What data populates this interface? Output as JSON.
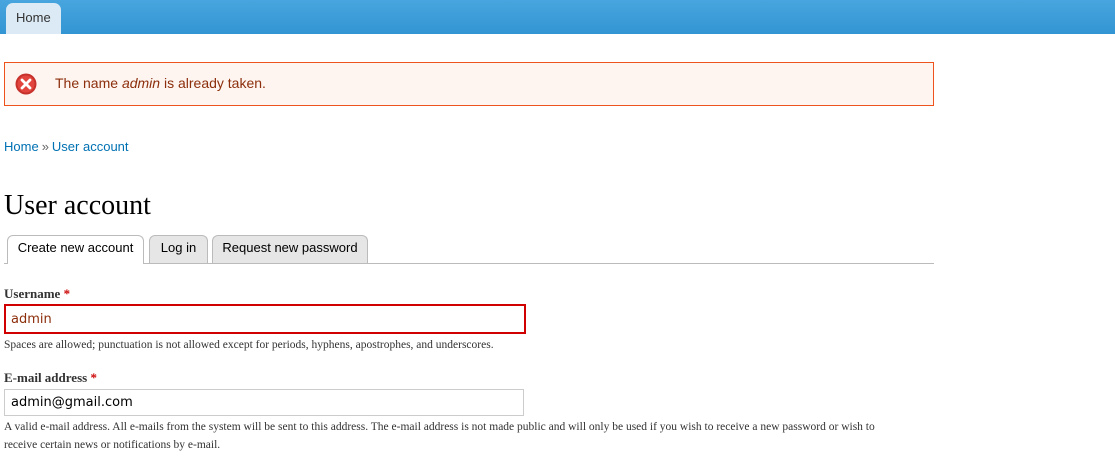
{
  "topbar": {
    "home_tab_label": "Home"
  },
  "error": {
    "icon": "error-x-icon",
    "text_before": "The name ",
    "text_name": "admin",
    "text_after": " is already taken."
  },
  "breadcrumb": {
    "home": "Home",
    "separator": "»",
    "current": "User account"
  },
  "page": {
    "title": "User account"
  },
  "tabs": [
    {
      "label": "Create new account",
      "active": true
    },
    {
      "label": "Log in",
      "active": false
    },
    {
      "label": "Request new password",
      "active": false
    }
  ],
  "form": {
    "username": {
      "label": "Username",
      "required_marker": "*",
      "value": "admin",
      "description": "Spaces are allowed; punctuation is not allowed except for periods, hyphens, apostrophes, and underscores."
    },
    "email": {
      "label": "E-mail address",
      "required_marker": "*",
      "value": "admin@gmail.com",
      "description_line1": "A valid e-mail address. All e-mails from the system will be sent to this address. The e-mail address is not made public and will only be used if you wish to receive a new password or wish to",
      "description_line2": "receive certain news or notifications by e-mail."
    }
  },
  "colors": {
    "topbar": "#3b9ddb",
    "error_border": "#ed541d",
    "error_text": "#8c2e0b",
    "link": "#0071b3",
    "invalid_border": "#d00000",
    "required": "#cc0000"
  }
}
